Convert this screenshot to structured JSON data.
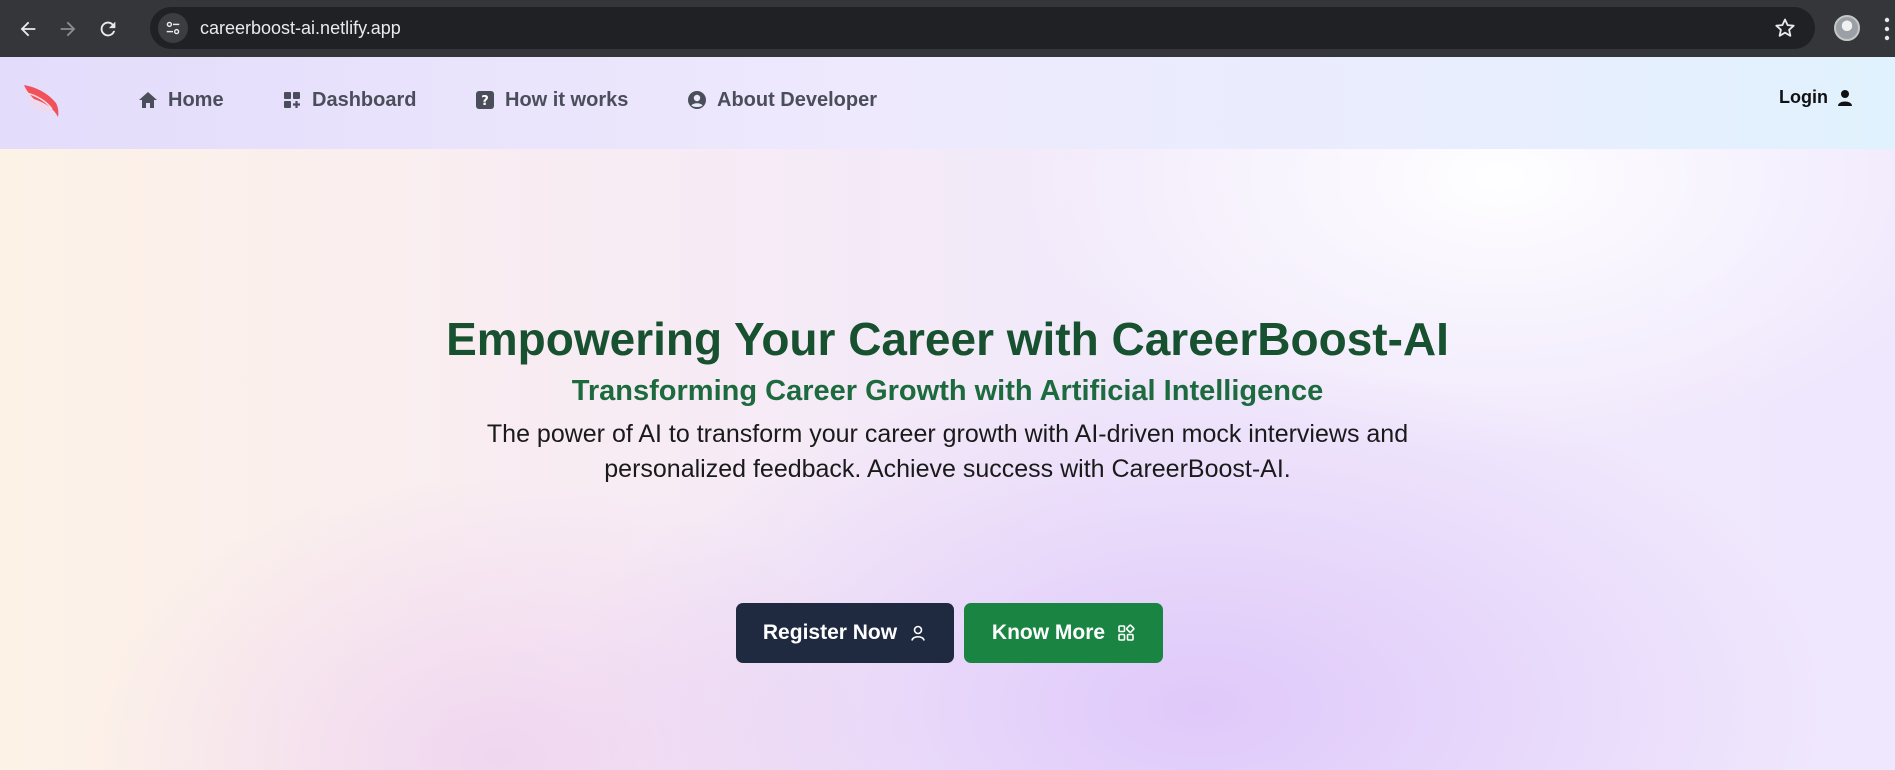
{
  "browser": {
    "url": "careerboost-ai.netlify.app",
    "back_icon": "arrow-left-icon",
    "forward_icon": "arrow-right-icon",
    "reload_icon": "reload-icon",
    "bookmark_icon": "star-icon"
  },
  "header": {
    "logo_icon": "wing-logo-icon",
    "nav": [
      {
        "label": "Home",
        "icon": "home-icon"
      },
      {
        "label": "Dashboard",
        "icon": "dashboard-icon"
      },
      {
        "label": "How it works",
        "icon": "question-icon"
      },
      {
        "label": "About Developer",
        "icon": "user-circle-icon"
      }
    ],
    "login": {
      "label": "Login",
      "icon": "user-icon"
    }
  },
  "hero": {
    "title": "Empowering Your Career with CareerBoost-AI",
    "subtitle": "Transforming Career Growth with Artificial Intelligence",
    "description": "The power of AI to transform your career growth with AI-driven mock interviews and personalized feedback. Achieve success with CareerBoost-AI.",
    "buttons": {
      "register": {
        "label": "Register Now",
        "icon": "user-outline-icon"
      },
      "know_more": {
        "label": "Know More",
        "icon": "apps-icon"
      }
    }
  },
  "colors": {
    "title_green": "#175130",
    "subtitle_green": "#1c6a3e",
    "register_bg": "#1f2a40",
    "know_more_bg": "#1a8443",
    "logo_red": "#f0525c"
  }
}
